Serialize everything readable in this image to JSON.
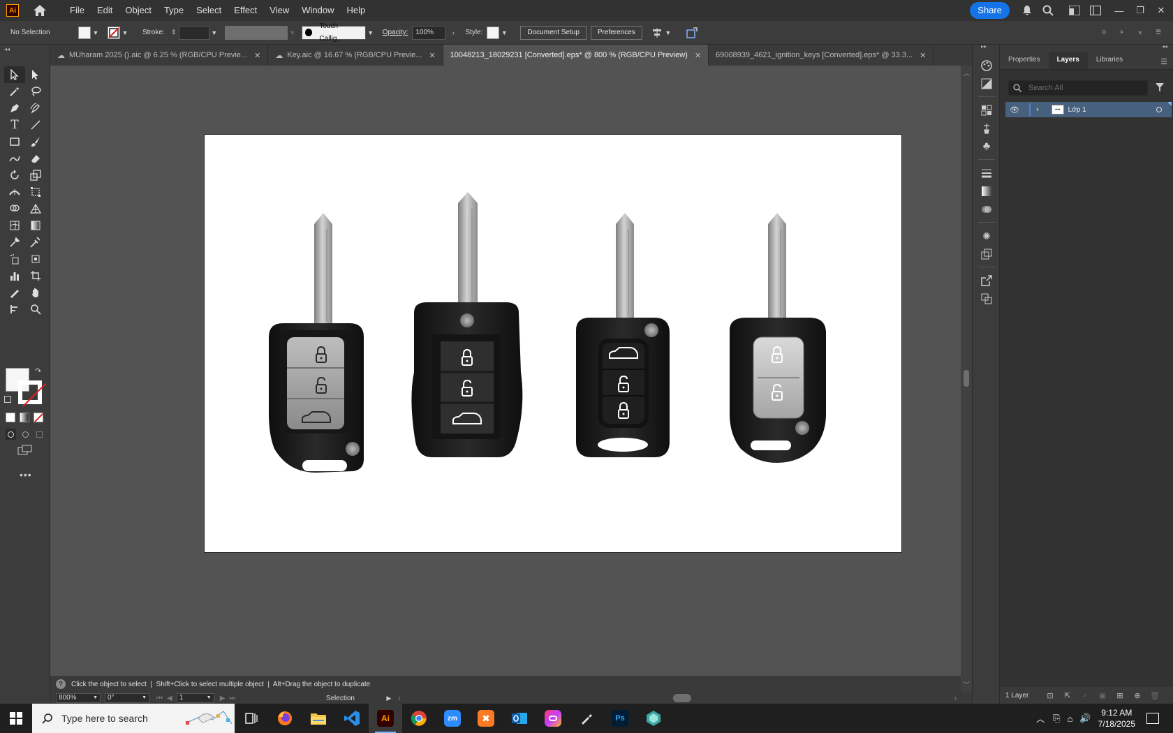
{
  "app": {
    "logo": "Ai",
    "menu": [
      "File",
      "Edit",
      "Object",
      "Type",
      "Select",
      "Effect",
      "View",
      "Window",
      "Help"
    ],
    "share_label": "Share"
  },
  "control_bar": {
    "selection_label": "No Selection",
    "stroke_label": "Stroke:",
    "brush_value": "Touch Callig...",
    "opacity_label": "Opacity:",
    "opacity_value": "100%",
    "style_label": "Style:",
    "document_setup_label": "Document Setup",
    "preferences_label": "Preferences"
  },
  "tabs": [
    {
      "label": "MUharam 2025 ().aic @ 6.25 % (RGB/CPU Previe...",
      "cloud": true,
      "active": false
    },
    {
      "label": "Key.aic @ 16.67 % (RGB/CPU Previe...",
      "cloud": true,
      "active": false
    },
    {
      "label": "10048213_18029231 [Converted].eps* @ 800 % (RGB/CPU Preview)",
      "cloud": false,
      "active": true
    },
    {
      "label": "69008939_4621_ignition_keys [Converted].eps* @ 33.3...",
      "cloud": false,
      "active": false
    }
  ],
  "status": {
    "hint": "Click the object to select  |  Shift+Click to select multiple object  |  Alt+Drag the object to duplicate",
    "zoom": "800%",
    "rotation": "0°",
    "artboard_number": "1",
    "tool_name": "Selection"
  },
  "panel": {
    "tabs": [
      "Properties",
      "Layers",
      "Libraries"
    ],
    "active_tab": "Layers",
    "search_placeholder": "Search All",
    "layers": [
      {
        "name": "Lớp 1",
        "visible": true
      }
    ],
    "layer_count": "1 Layer"
  },
  "taskbar": {
    "search_placeholder": "Type here to search",
    "apps": [
      "task-view",
      "firefox",
      "file-explorer",
      "vscode",
      "illustrator",
      "chrome",
      "zoom",
      "xampp",
      "outlook",
      "creative-cloud",
      "pen-tool",
      "photoshop",
      "other-app"
    ],
    "time": "9:12 AM",
    "date": "7/18/2025"
  },
  "colors": {
    "accent": "#1473e6",
    "illustrator_orange": "#ff9a00",
    "layer_selected": "#46607e",
    "key_fob_body": "#1b1b1b",
    "key_blade": "#b5b5b5"
  }
}
